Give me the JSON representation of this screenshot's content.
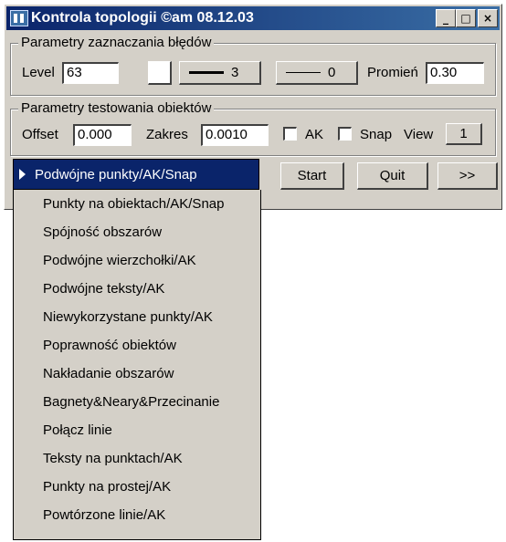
{
  "window": {
    "title": "Kontrola topologii ©am 08.12.03",
    "buttons": {
      "minimize": "_",
      "maximize": "□",
      "close": "×"
    }
  },
  "error_marking": {
    "legend": "Parametry zaznaczania błędów",
    "level_label": "Level",
    "level_value": "63",
    "line_button_1_value": "3",
    "line_button_2_value": "0",
    "radius_label": "Promień",
    "radius_value": "0.30"
  },
  "object_testing": {
    "legend": "Parametry testowania obiektów",
    "offset_label": "Offset",
    "offset_value": "0.000",
    "range_label": "Zakres",
    "range_value": "0.0010",
    "ak_label": "AK",
    "snap_label": "Snap",
    "view_label": "View",
    "view_value": "1"
  },
  "actions": {
    "start": "Start",
    "quit": "Quit",
    "more": ">>"
  },
  "mode_select": {
    "selected": "Podwójne punkty/AK/Snap",
    "options": [
      "Punkty na obiektach/AK/Snap",
      "Spójność obszarów",
      "Podwójne wierzchołki/AK",
      "Podwójne teksty/AK",
      "Niewykorzystane punkty/AK",
      "Poprawność obiektów",
      "Nakładanie obszarów",
      "Bagnety&Neary&Przecinanie",
      "Połącz linie",
      "Teksty na punktach/AK",
      "Punkty na prostej/AK",
      "Powtórzone linie/AK"
    ]
  },
  "colors": {
    "titlebar": "#0a246a",
    "selection": "#0a246a",
    "face": "#d4d0c8"
  }
}
